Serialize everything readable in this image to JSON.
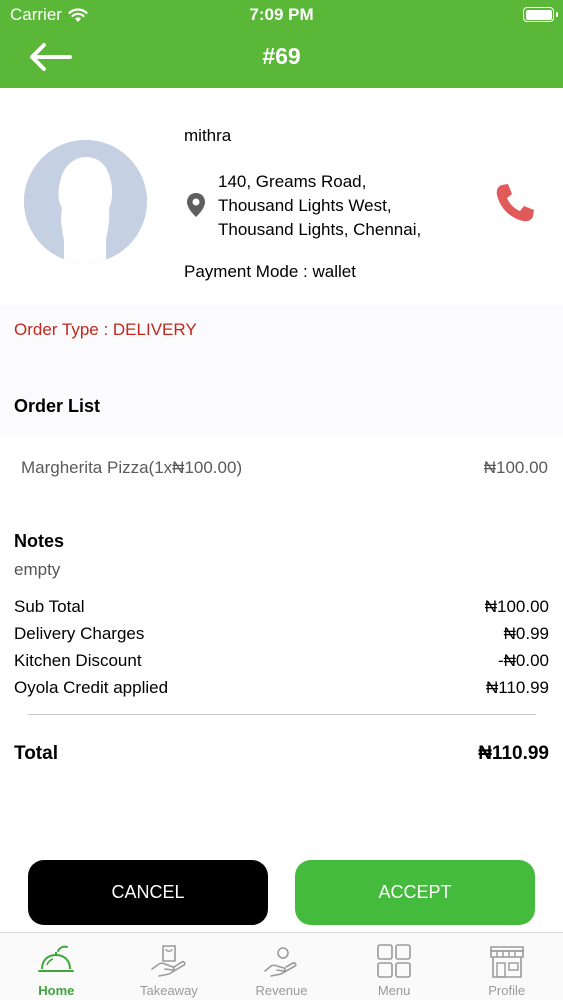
{
  "status_bar": {
    "carrier": "Carrier",
    "time": "7:09 PM"
  },
  "header": {
    "title": "#69",
    "back_icon": "arrow-left-icon",
    "background": "#5ab738"
  },
  "customer": {
    "name": "mithra",
    "address_lines": [
      "140, Greams Road,",
      "Thousand Lights West,",
      "Thousand Lights, Chennai,"
    ],
    "payment_mode": "Payment Mode : wallet"
  },
  "order_type": "Order Type : DELIVERY",
  "order_list": {
    "title": "Order List",
    "items": [
      {
        "name": "Margherita Pizza(1x₦100.00)",
        "price": "₦100.00"
      }
    ]
  },
  "notes": {
    "title": "Notes",
    "text": "empty"
  },
  "summary": [
    {
      "label": "Sub Total",
      "value": "₦100.00"
    },
    {
      "label": "Delivery Charges",
      "value": "₦0.99"
    },
    {
      "label": "Kitchen Discount",
      "value": "-₦0.00"
    },
    {
      "label": "Oyola Credit applied",
      "value": "₦110.99"
    }
  ],
  "total": {
    "label": "Total",
    "value": "₦110.99"
  },
  "actions": {
    "cancel_label": "CANCEL",
    "accept_label": "ACCEPT",
    "accept_color": "#45bb3d"
  },
  "tabs": [
    {
      "label": "Home",
      "icon": "food-cloche-icon",
      "active": true
    },
    {
      "label": "Takeaway",
      "icon": "takeaway-bag-hand-icon",
      "active": false
    },
    {
      "label": "Revenue",
      "icon": "revenue-hand-icon",
      "active": false
    },
    {
      "label": "Menu",
      "icon": "grid-menu-icon",
      "active": false
    },
    {
      "label": "Profile",
      "icon": "store-front-icon",
      "active": false
    }
  ]
}
